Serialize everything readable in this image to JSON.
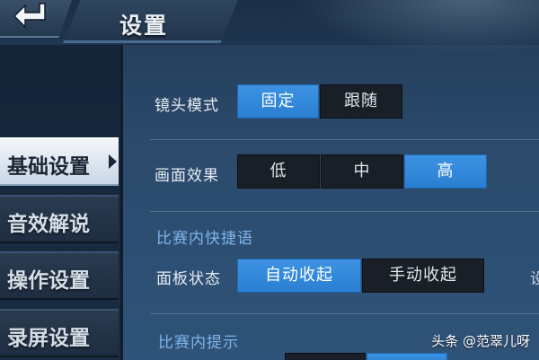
{
  "header": {
    "title": "设置",
    "back_icon": "back-arrow-icon"
  },
  "sidebar": {
    "items": [
      {
        "label": "基础设置",
        "active": true
      },
      {
        "label": "音效解说",
        "active": false
      },
      {
        "label": "操作设置",
        "active": false
      },
      {
        "label": "录屏设置",
        "active": false
      }
    ]
  },
  "settings": {
    "camera_mode": {
      "label": "镜头模式",
      "options": [
        "固定",
        "跟随"
      ],
      "selected": "固定"
    },
    "graphics": {
      "label": "画面效果",
      "options": [
        "低",
        "中",
        "高"
      ],
      "selected": "高"
    },
    "quick_chat": {
      "section_title": "比赛内快捷语",
      "panel_state": {
        "label": "面板状态",
        "options": [
          "自动收起",
          "手动收起"
        ],
        "selected": "自动收起"
      },
      "cut_off_text": "设"
    },
    "in_match_tips": {
      "section_title": "比赛内提示"
    }
  },
  "watermark": "头条 @范翠儿呀",
  "colors": {
    "selected": "#2f86d6",
    "unselected": "#1a1f27",
    "section_title": "#7fb4ea",
    "active_tab": "#e8eef5"
  }
}
